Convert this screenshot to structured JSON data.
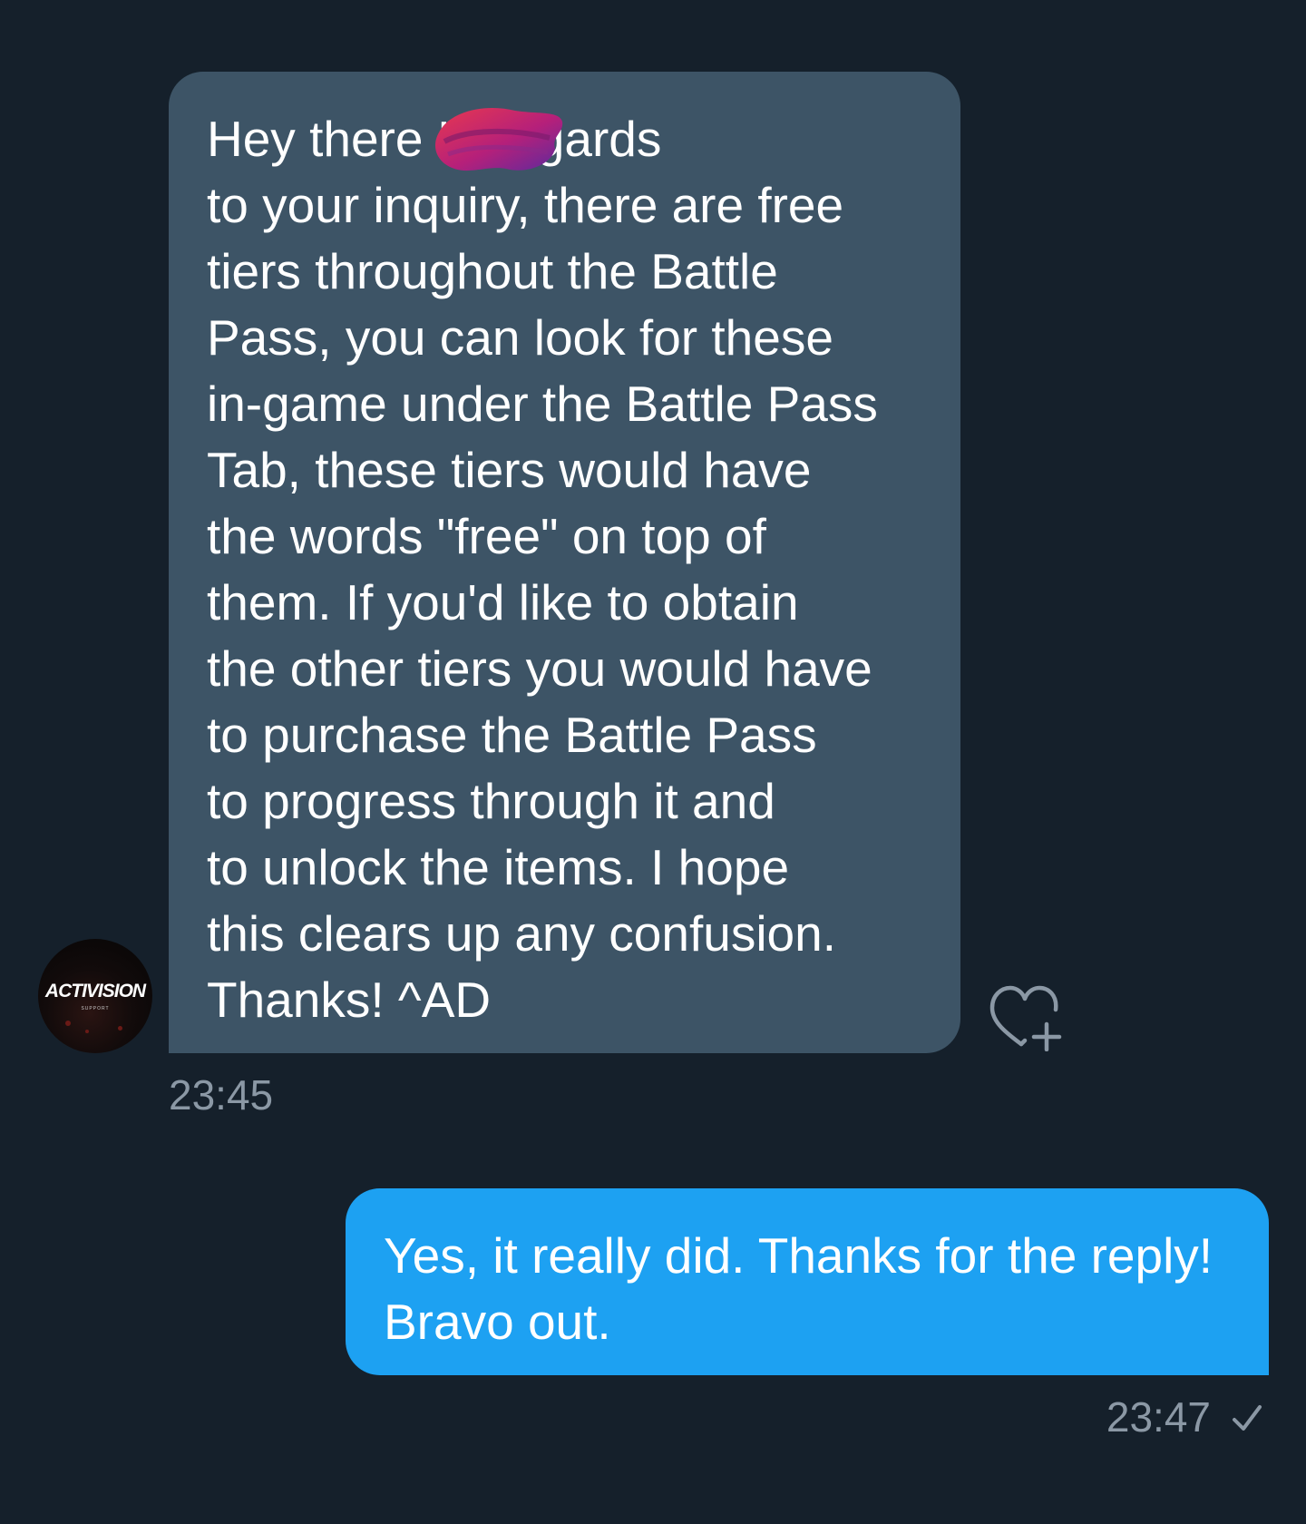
{
  "incoming": {
    "avatar": {
      "brand": "ACTIVISION",
      "sub": "SUPPORT"
    },
    "text": "Hey there        In regards\nto your inquiry, there are free\ntiers throughout the Battle\nPass, you can look for these\nin-game under the Battle Pass\nTab, these tiers would have\nthe words \"free\" on top of\nthem. If you'd like to obtain\nthe other tiers you would have\nto purchase the Battle Pass\nto progress through it and\nto unlock the items. I hope\nthis clears up any confusion.\nThanks! ^AD",
    "time": "23:45",
    "like_icon": "heart-plus-icon"
  },
  "outgoing": {
    "text": "Yes, it really did. Thanks for the reply!\nBravo out.",
    "time": "23:47",
    "status_icon": "checkmark-icon"
  },
  "colors": {
    "background": "#15202b",
    "incoming_bubble": "#3d5466",
    "outgoing_bubble": "#1da1f2",
    "timestamp": "#8b98a5"
  }
}
